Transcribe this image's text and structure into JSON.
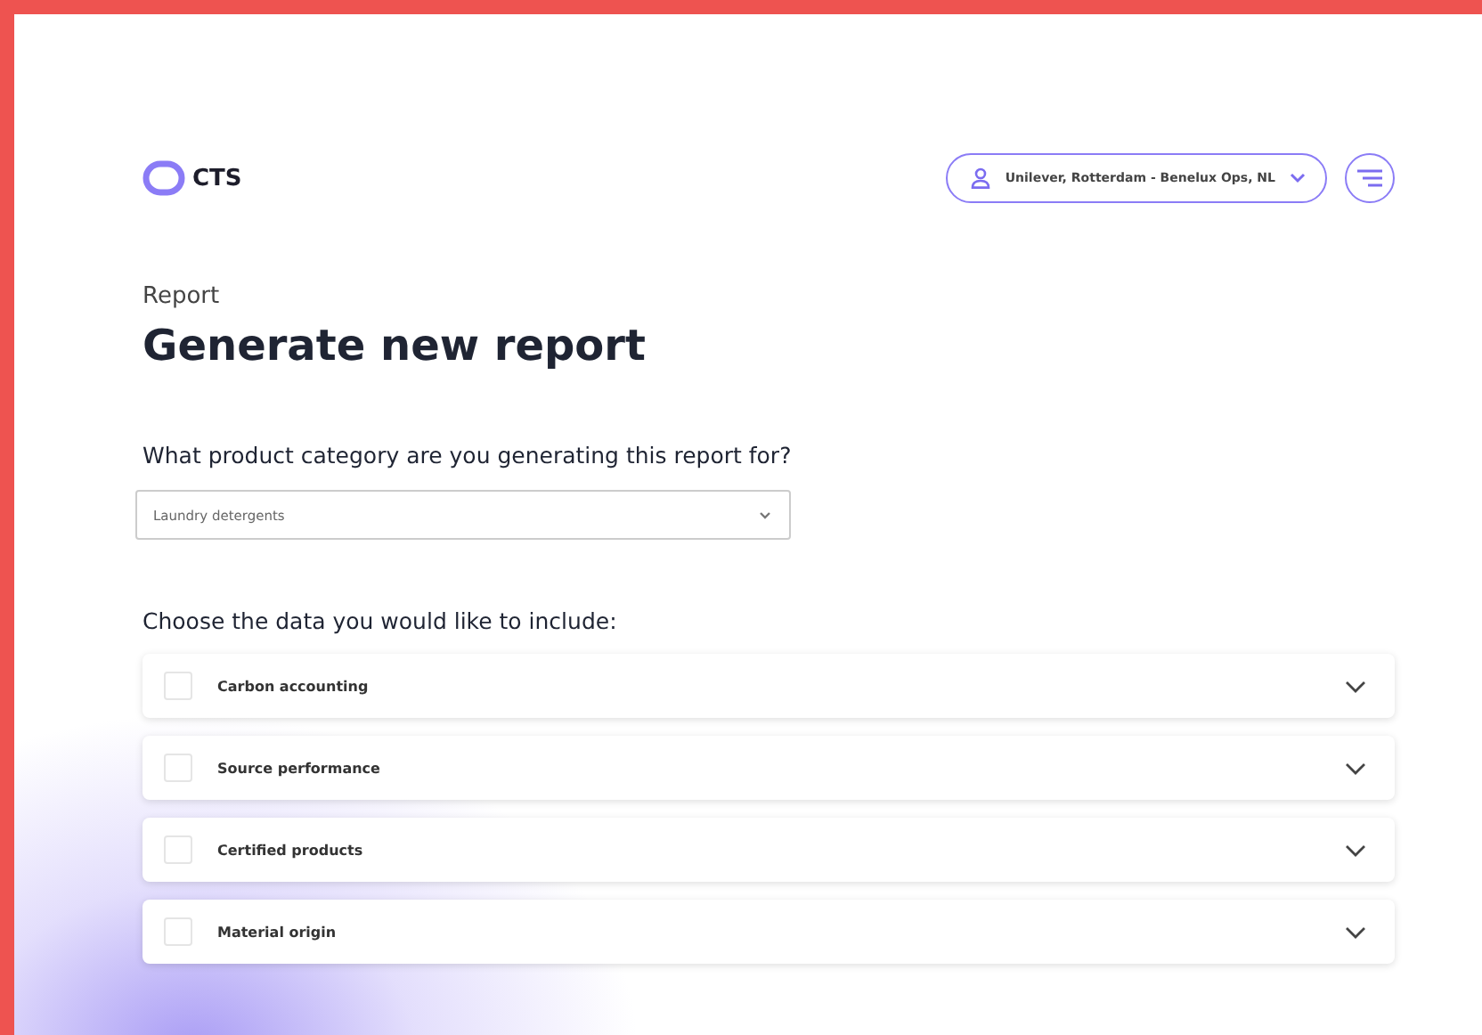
{
  "header": {
    "logo": "CTS",
    "account": "Unilever, Rotterdam - Benelux Ops, NL"
  },
  "breadcrumb": "Report",
  "title": "Generate new report",
  "category": {
    "question": "What product category are you generating this report for?",
    "value": "Laundry detergents"
  },
  "data_section": {
    "heading": "Choose the data you would like to include:",
    "items": [
      {
        "label": "Carbon accounting",
        "checked": false
      },
      {
        "label": "Source performance",
        "checked": false
      },
      {
        "label": "Certified products",
        "checked": false
      },
      {
        "label": "Material origin",
        "checked": false
      }
    ]
  }
}
